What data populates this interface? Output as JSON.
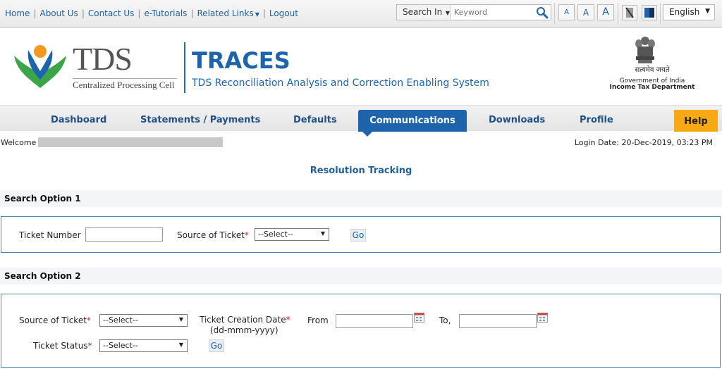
{
  "topbar": {
    "links": [
      "Home",
      "About Us",
      "Contact Us",
      "e-Tutorials",
      "Related Links",
      "Logout"
    ],
    "search_in_label": "Search In",
    "search_placeholder": "Keyword",
    "font_sizes": [
      "A",
      "A",
      "A"
    ],
    "language": "English"
  },
  "header": {
    "logo_text": "TDS",
    "logo_sub": "Centralized Processing Cell",
    "brand": "TRACES",
    "brand_sub": "TDS Reconciliation Analysis and Correction Enabling System",
    "emblem_motto": "सत्यमेव जयते",
    "gov_line1": "Government of India",
    "gov_line2": "Income Tax Department"
  },
  "nav": {
    "items": [
      "Dashboard",
      "Statements / Payments",
      "Defaults",
      "Communications",
      "Downloads",
      "Profile",
      "Help"
    ],
    "active": "Communications"
  },
  "welcome": {
    "label": "Welcome",
    "login_date": "Login Date: 20-Dec-2019, 03:23 PM"
  },
  "page": {
    "title": "Resolution Tracking"
  },
  "option1": {
    "title": "Search Option 1",
    "ticket_number_label": "Ticket Number",
    "source_label": "Source of Ticket",
    "source_value": "--Select--",
    "go": "Go"
  },
  "option2": {
    "title": "Search Option 2",
    "source_label": "Source of Ticket",
    "source_value": "--Select--",
    "creation_label": "Ticket Creation Date",
    "date_format": "(dd-mmm-yyyy)",
    "from_label": "From",
    "to_label": "To,",
    "status_label": "Ticket Status",
    "status_value": "--Select--",
    "go": "Go"
  },
  "colors": {
    "brand_blue": "#1d64ad",
    "help_orange": "#f7a812",
    "required_red": "#d02020"
  }
}
